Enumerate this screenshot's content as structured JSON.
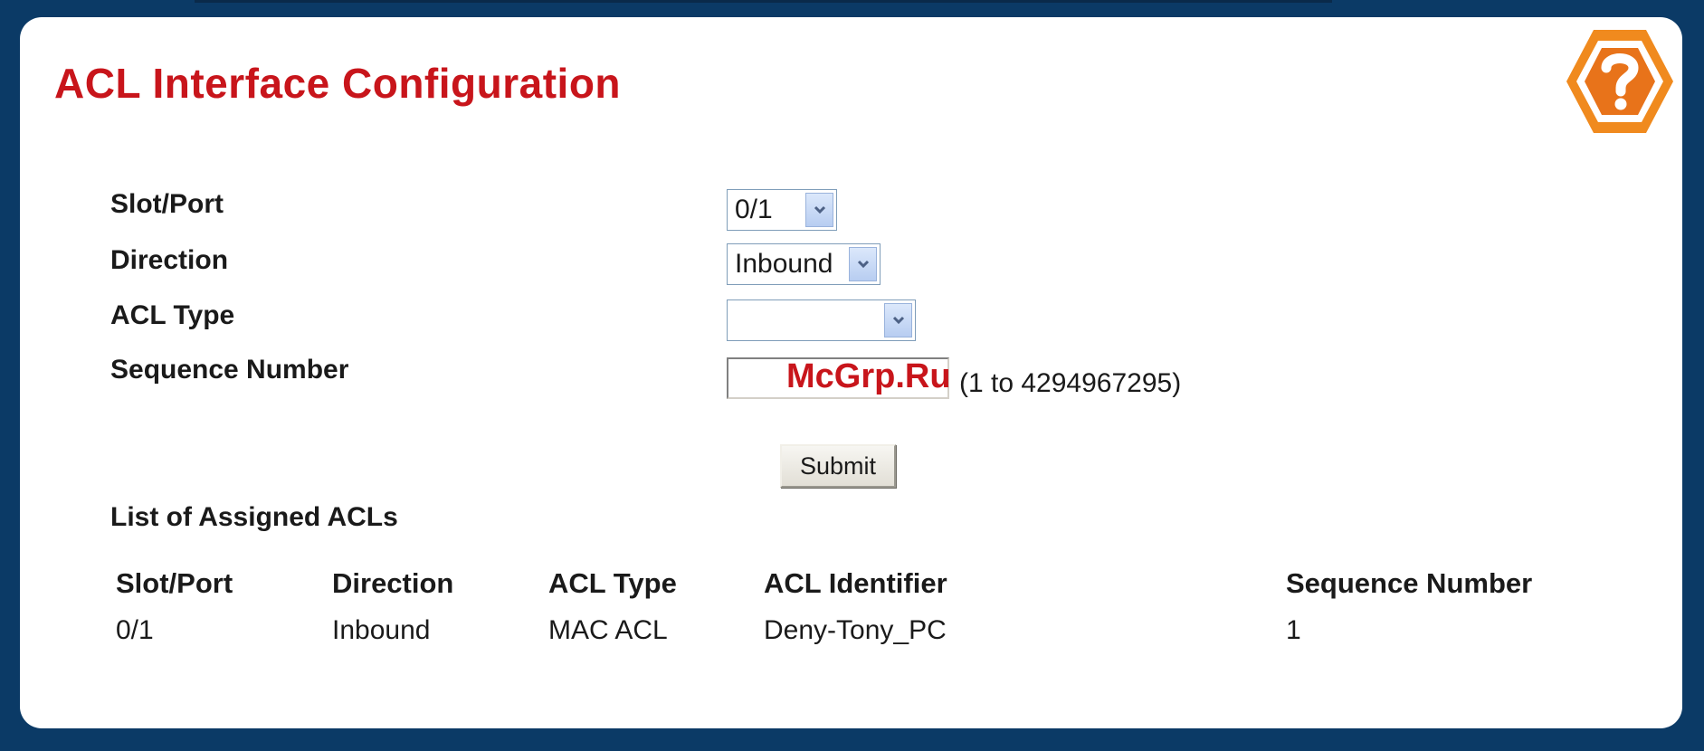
{
  "page": {
    "title": "ACL Interface Configuration",
    "help_icon": "question-mark-hexagon-icon",
    "watermark": "McGrp.Ru"
  },
  "form": {
    "slot_port": {
      "label": "Slot/Port",
      "value": "0/1"
    },
    "direction": {
      "label": "Direction",
      "value": "Inbound"
    },
    "acl_type": {
      "label": "ACL Type",
      "value": ""
    },
    "sequence_number": {
      "label": "Sequence Number",
      "value": "",
      "hint": "(1 to 4294967295)"
    },
    "submit_label": "Submit"
  },
  "assigned": {
    "title": "List of Assigned ACLs",
    "columns": [
      "Slot/Port",
      "Direction",
      "ACL Type",
      "ACL Identifier",
      "Sequence Number"
    ],
    "rows": [
      [
        "0/1",
        "Inbound",
        "MAC ACL",
        "Deny-Tony_PC",
        "1"
      ]
    ]
  },
  "colors": {
    "title": "#c8151b",
    "frame": "#0b3a66",
    "help_orange": "#f08a1e"
  }
}
